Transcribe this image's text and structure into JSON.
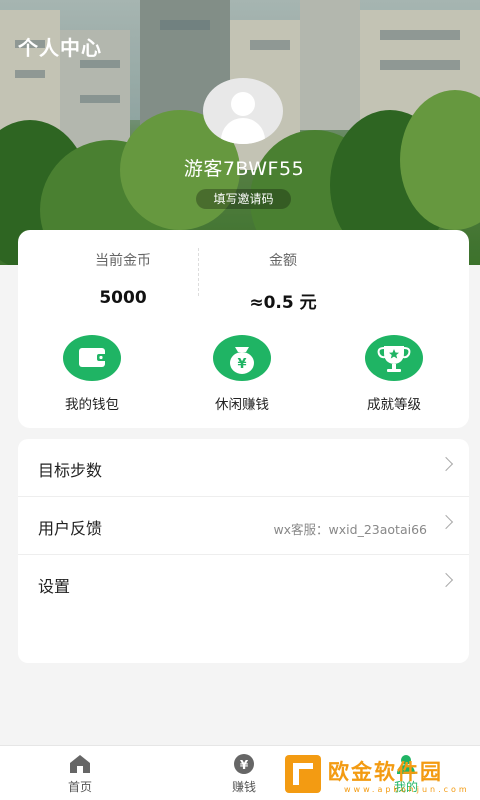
{
  "header": {
    "title": "个人中心"
  },
  "profile": {
    "username": "游客7BWF55",
    "invite_label": "填写邀请码"
  },
  "stats": {
    "coins_label": "当前金币",
    "coins_value": "5000",
    "amount_label": "金额",
    "amount_value": "≈0.5 元"
  },
  "actions": [
    {
      "label": "我的钱包",
      "icon": "wallet-icon"
    },
    {
      "label": "休闲赚钱",
      "icon": "money-bag-icon"
    },
    {
      "label": "成就等级",
      "icon": "trophy-icon"
    }
  ],
  "menu": [
    {
      "label": "目标步数",
      "extra": ""
    },
    {
      "label": "用户反馈",
      "extra": "wx客服：wxid_23aotai66"
    },
    {
      "label": "设置",
      "extra": ""
    }
  ],
  "tabs": [
    {
      "label": "首页",
      "icon": "home-icon"
    },
    {
      "label": "赚钱",
      "icon": "yen-coin-icon"
    },
    {
      "label": "我的",
      "icon": "user-icon"
    }
  ],
  "watermark": {
    "text": "欧金软件园",
    "url": "www.apkohjun.com"
  },
  "colors": {
    "accent": "#1fb464",
    "watermark": "#f39b12"
  }
}
